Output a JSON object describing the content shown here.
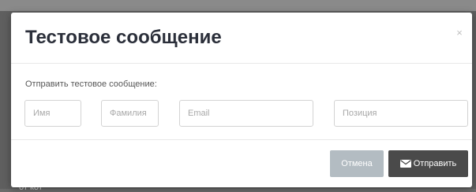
{
  "background": {
    "partial_text": "от кот"
  },
  "modal": {
    "title": "Тестовое сообщение",
    "close_symbol": "×",
    "prompt_label": "Отправить тестовое сообщение:",
    "fields": {
      "first_name": {
        "placeholder": "Имя",
        "value": ""
      },
      "last_name": {
        "placeholder": "Фамилия",
        "value": ""
      },
      "email": {
        "placeholder": "Email",
        "value": ""
      },
      "position": {
        "placeholder": "Позиция",
        "value": ""
      }
    },
    "buttons": {
      "cancel_label": "Отмена",
      "send_label": "Отправить",
      "send_icon": "envelope-icon"
    }
  },
  "colors": {
    "cancel_button": "#b3bcc2",
    "send_button": "#4a4a4a",
    "title_text": "#2b2f3a"
  }
}
